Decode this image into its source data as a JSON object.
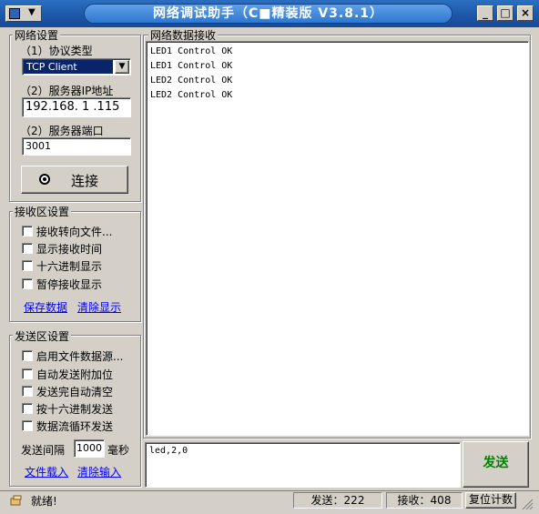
{
  "window": {
    "title": "网络调试助手（C■精装版 V3.8.1）"
  },
  "network": {
    "group_label": "网络设置",
    "protocol_label": "（1）协议类型",
    "protocol_value": "TCP Client",
    "ip_label": "（2）服务器IP地址",
    "ip_value": "192.168. 1 .115",
    "port_label": "（2）服务器端口",
    "port_value": "3001",
    "connect_label": "连接"
  },
  "receive_settings": {
    "group_label": "接收区设置",
    "options": [
      "接收转向文件...",
      "显示接收时间",
      "十六进制显示",
      "暂停接收显示"
    ],
    "save_link": "保存数据",
    "clear_link": "清除显示"
  },
  "send_settings": {
    "group_label": "发送区设置",
    "options": [
      "启用文件数据源...",
      "自动发送附加位",
      "发送完自动清空",
      "按十六进制发送",
      "数据流循环发送"
    ],
    "interval_label": "发送间隔",
    "interval_value": "1000",
    "interval_unit": "毫秒",
    "load_link": "文件载入",
    "clear_link": "清除输入"
  },
  "receive_area": {
    "group_label": "网络数据接收",
    "lines": [
      "LED1 Control OK",
      "LED1 Control OK",
      "LED2 Control OK",
      "LED2 Control OK"
    ]
  },
  "send_area": {
    "input_value": "led,2,0",
    "send_button": "发送"
  },
  "status_bar": {
    "status_text": "就绪!",
    "sent_label": "发送：222",
    "recv_label": "接收：408",
    "reset_button": "复位计数"
  }
}
